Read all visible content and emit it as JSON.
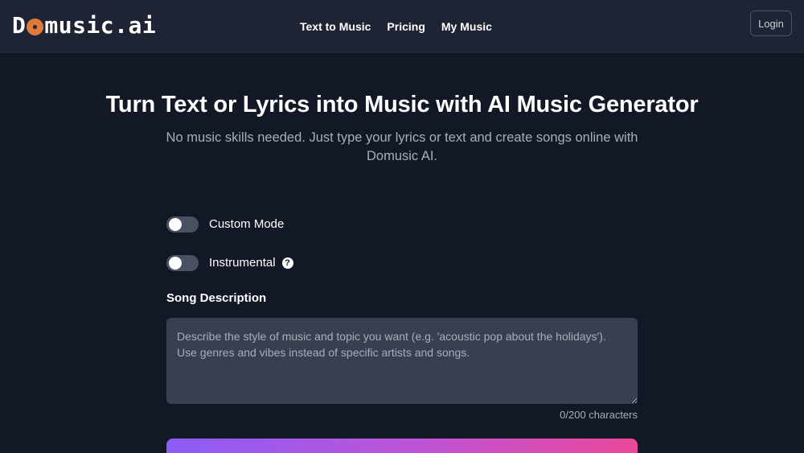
{
  "header": {
    "logo": {
      "prefix": "D",
      "suffix": "music.ai",
      "disc_icon": "vinyl-disc-icon",
      "disc_color": "#e07a3a"
    },
    "nav": [
      {
        "label": "Text to Music"
      },
      {
        "label": "Pricing"
      },
      {
        "label": "My Music"
      }
    ],
    "login_label": "Login"
  },
  "hero": {
    "title": "Turn Text or Lyrics into Music with AI Music Generator",
    "subtitle": "No music skills needed. Just type your lyrics or text and create songs online with Domusic AI."
  },
  "form": {
    "custom_mode": {
      "label": "Custom Mode",
      "enabled": false
    },
    "instrumental": {
      "label": "Instrumental",
      "enabled": false,
      "help_icon": "question-circle-icon",
      "help_glyph": "?"
    },
    "song_description": {
      "label": "Song Description",
      "value": "",
      "placeholder": "Describe the style of music and topic you want (e.g. 'acoustic pop about the holidays'). Use genres and vibes instead of specific artists and songs.",
      "counter": "0/200 characters"
    }
  },
  "colors": {
    "background": "#131826",
    "header": "#1e2433",
    "gradient_start": "#8b5cf6",
    "gradient_end": "#ec4899"
  }
}
